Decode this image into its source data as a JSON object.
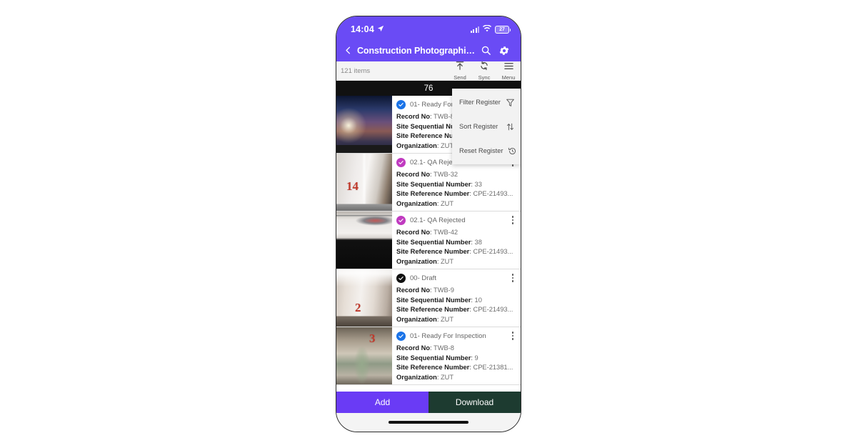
{
  "status_bar": {
    "time": "14:04",
    "location_icon": "location-arrow-icon",
    "signal_icon": "cellular-signal-icon",
    "wifi_icon": "wifi-icon",
    "battery_level": "27"
  },
  "app_bar": {
    "back_icon": "back-chevron-icon",
    "title": "Construction Photographic...",
    "search_icon": "search-icon",
    "settings_icon": "gear-icon"
  },
  "toolbar": {
    "items_count": "121 items",
    "actions": [
      {
        "label": "Send",
        "icon": "send-up-arrow-icon"
      },
      {
        "label": "Sync",
        "icon": "sync-refresh-icon"
      },
      {
        "label": "Menu",
        "icon": "hamburger-menu-icon"
      }
    ]
  },
  "dropdown_menu": {
    "visible": true,
    "items": [
      {
        "label": "Filter Register",
        "icon": "filter-funnel-icon"
      },
      {
        "label": "Sort Register",
        "icon": "sort-arrows-icon"
      },
      {
        "label": "Reset Register",
        "icon": "reset-history-icon"
      }
    ]
  },
  "group_banner": {
    "label": "76"
  },
  "field_labels": {
    "record_no": "Record No",
    "site_sequential_number": "Site Sequential Number",
    "site_reference_number": "Site Reference Number",
    "organization": "Organization"
  },
  "records": [
    {
      "status": "01- Ready For Inspection",
      "status_color": "#1a73e8",
      "status_icon": "check-circle-icon",
      "record_no": "TWB-85",
      "site_sequential_number": "",
      "site_reference_number": "",
      "organization": "ZUT",
      "thumb_mark": ""
    },
    {
      "status": "02.1- QA Rejected",
      "status_color": "#c03ac0",
      "status_icon": "check-circle-icon",
      "record_no": "TWB-32",
      "site_sequential_number": "33",
      "site_reference_number": "CPE-21493...",
      "organization": "ZUT",
      "thumb_mark": "14"
    },
    {
      "status": "02.1- QA Rejected",
      "status_color": "#c03ac0",
      "status_icon": "check-circle-icon",
      "record_no": "TWB-42",
      "site_sequential_number": "38",
      "site_reference_number": "CPE-21493...",
      "organization": "ZUT",
      "thumb_mark": ""
    },
    {
      "status": "00- Draft",
      "status_color": "#111111",
      "status_icon": "check-circle-icon",
      "record_no": "TWB-9",
      "site_sequential_number": "10",
      "site_reference_number": "CPE-21493...",
      "organization": "ZUT",
      "thumb_mark": "2"
    },
    {
      "status": "01- Ready For Inspection",
      "status_color": "#1a73e8",
      "status_icon": "check-circle-icon",
      "record_no": "TWB-8",
      "site_sequential_number": "9",
      "site_reference_number": "CPE-21381...",
      "organization": "ZUT",
      "thumb_mark": "3"
    }
  ],
  "bottom_bar": {
    "add_label": "Add",
    "add_color": "#6a3bf5",
    "download_label": "Download",
    "download_color": "#1d3b30"
  },
  "theme": {
    "primary": "#6a4bf5",
    "banner_bg": "#111111"
  }
}
